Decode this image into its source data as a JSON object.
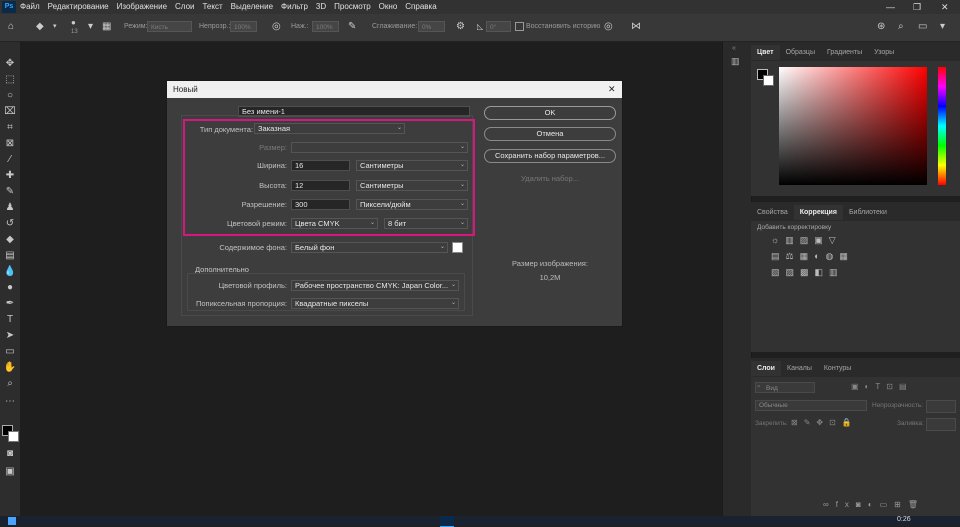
{
  "menu": [
    "Файл",
    "Редактирование",
    "Изображение",
    "Слои",
    "Текст",
    "Выделение",
    "Фильтр",
    "3D",
    "Просмотр",
    "Окно",
    "Справка"
  ],
  "app_logo": "Ps",
  "window_controls": {
    "minimize": "—",
    "maximize": "❐",
    "close": "✕"
  },
  "options_bar": {
    "brush_size": "13",
    "mode_label": "Режим:",
    "mode_value": "Кисть",
    "opacity_label": "Непрозр.:",
    "opacity_value": "100%",
    "pressure_label": "Наж.:",
    "pressure_value": "100%",
    "smoothing_label": "Сглаживание:",
    "smoothing_value": "0%",
    "angle_value": "0°",
    "restore_history_label": "Восстановить историю"
  },
  "right_panels": {
    "color_tabs": [
      "Цвет",
      "Образцы",
      "Градиенты",
      "Узоры"
    ],
    "adjust_tabs": [
      "Свойства",
      "Коррекция",
      "Библиотеки"
    ],
    "adjust_hint": "Добавить корректировку",
    "layers_tabs": [
      "Слои",
      "Каналы",
      "Контуры"
    ],
    "layers_search": "Вид",
    "blend_mode": "Обычные",
    "opacity_label": "Непрозрачность:",
    "lock_label": "Закрепить:",
    "fill_label": "Заливка:"
  },
  "dialog": {
    "title": "Новый",
    "close": "✕",
    "name_label": "Имя:",
    "name_value": "Без имени-1",
    "doc_type_label": "Тип документа:",
    "doc_type_value": "Заказная",
    "size_label": "Размер:",
    "width_label": "Ширина:",
    "width_value": "16",
    "width_unit": "Сантиметры",
    "height_label": "Высота:",
    "height_value": "12",
    "height_unit": "Сантиметры",
    "resolution_label": "Разрешение:",
    "resolution_value": "300",
    "resolution_unit": "Пиксели/дюйм",
    "color_mode_label": "Цветовой режим:",
    "color_mode_value": "Цвета CMYK",
    "bit_depth": "8 бит",
    "background_label": "Содержимое фона:",
    "background_value": "Белый фон",
    "advanced_label": "Дополнительно",
    "profile_label": "Цветовой профиль:",
    "profile_value": "Рабочее пространство CMYK:  Japan Color...",
    "pixel_ratio_label": "Попиксельная пропорция:",
    "pixel_ratio_value": "Квадратные пикселы",
    "ok_button": "OK",
    "cancel_button": "Отмена",
    "save_preset_button": "Сохранить набор параметров...",
    "delete_preset_button": "Удалить набор...",
    "image_size_label": "Размер изображения:",
    "image_size_value": "10,2M"
  },
  "taskbar": {
    "time": "0:26"
  },
  "colors": {
    "highlight": "#d6177e",
    "accent": "#31a8ff"
  }
}
